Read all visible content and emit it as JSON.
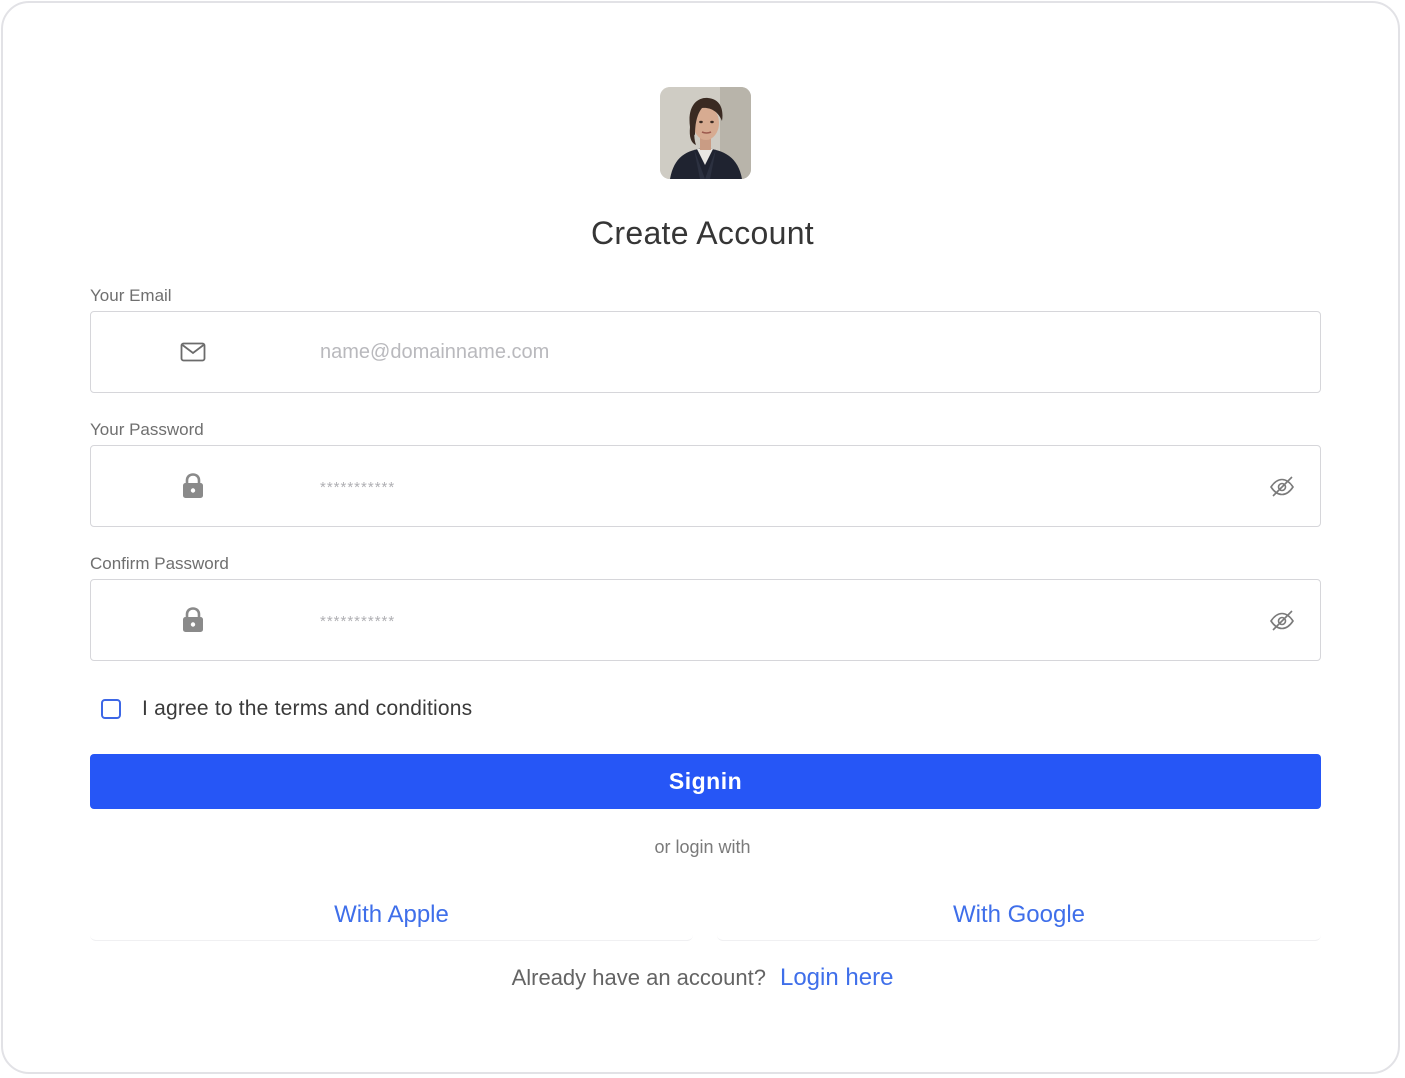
{
  "header": {
    "title": "Create Account"
  },
  "form": {
    "email": {
      "label": "Your Email",
      "placeholder": "name@domainname.com",
      "icon": "mail-icon"
    },
    "password": {
      "label": "Your Password",
      "placeholder": "***********",
      "icon": "lock-icon",
      "toggle_icon": "eye-off-icon"
    },
    "confirm_password": {
      "label": "Confirm Password",
      "placeholder": "***********",
      "icon": "lock-icon",
      "toggle_icon": "eye-off-icon"
    },
    "agree": {
      "label": "I agree to the terms and conditions",
      "checked": false
    },
    "submit_label": "Signin"
  },
  "social": {
    "divider_text": "or login with",
    "apple_label": "With Apple",
    "google_label": "With Google"
  },
  "footer": {
    "prompt": "Already have an account?",
    "link_label": "Login here"
  },
  "colors": {
    "primary": "#2656f6",
    "link": "#3f6fea",
    "border": "#d6d6da"
  }
}
